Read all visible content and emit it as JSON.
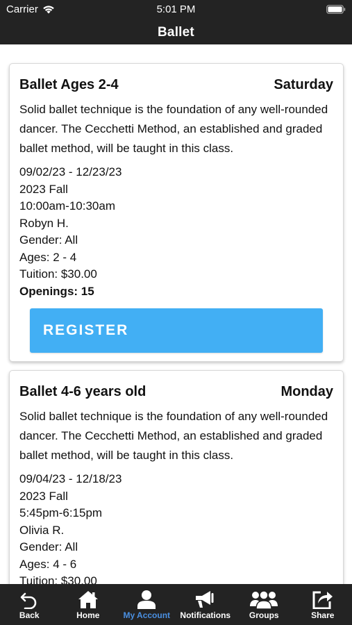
{
  "status_bar": {
    "carrier": "Carrier",
    "time": "5:01 PM"
  },
  "nav": {
    "title": "Ballet"
  },
  "classes": [
    {
      "name": "Ballet Ages 2-4",
      "day": "Saturday",
      "description": "Solid ballet technique is the foundation of any well-rounded dancer. The Cecchetti Method, an established and graded ballet method, will be taught in this class.",
      "dates": "09/02/23 - 12/23/23",
      "session": "2023 Fall",
      "time": "10:00am-10:30am",
      "instructor": "Robyn H.",
      "gender": "Gender: All",
      "ages": "Ages: 2 - 4",
      "tuition": "Tuition: $30.00",
      "openings": "Openings: 15",
      "register_label": "REGISTER"
    },
    {
      "name": "Ballet 4-6 years old",
      "day": "Monday",
      "description": "Solid ballet technique is the foundation of any well-rounded dancer. The Cecchetti Method, an established and graded ballet method, will be taught in this class.",
      "dates": "09/04/23 - 12/18/23",
      "session": "2023 Fall",
      "time": "5:45pm-6:15pm",
      "instructor": "Olivia R.",
      "gender": "Gender: All",
      "ages": "Ages: 4 - 6",
      "tuition": "Tuition: $30.00"
    }
  ],
  "tabs": [
    {
      "label": "Back",
      "icon": "back-arrow-icon"
    },
    {
      "label": "Home",
      "icon": "home-icon"
    },
    {
      "label": "My Account",
      "icon": "user-icon",
      "active": true
    },
    {
      "label": "Notifications",
      "icon": "megaphone-icon"
    },
    {
      "label": "Groups",
      "icon": "groups-icon"
    },
    {
      "label": "Share",
      "icon": "share-icon"
    }
  ],
  "colors": {
    "bar_background": "#232323",
    "register_button": "#42aff4",
    "openings_text": "#1a1adb",
    "active_tab": "#4a90e2"
  }
}
